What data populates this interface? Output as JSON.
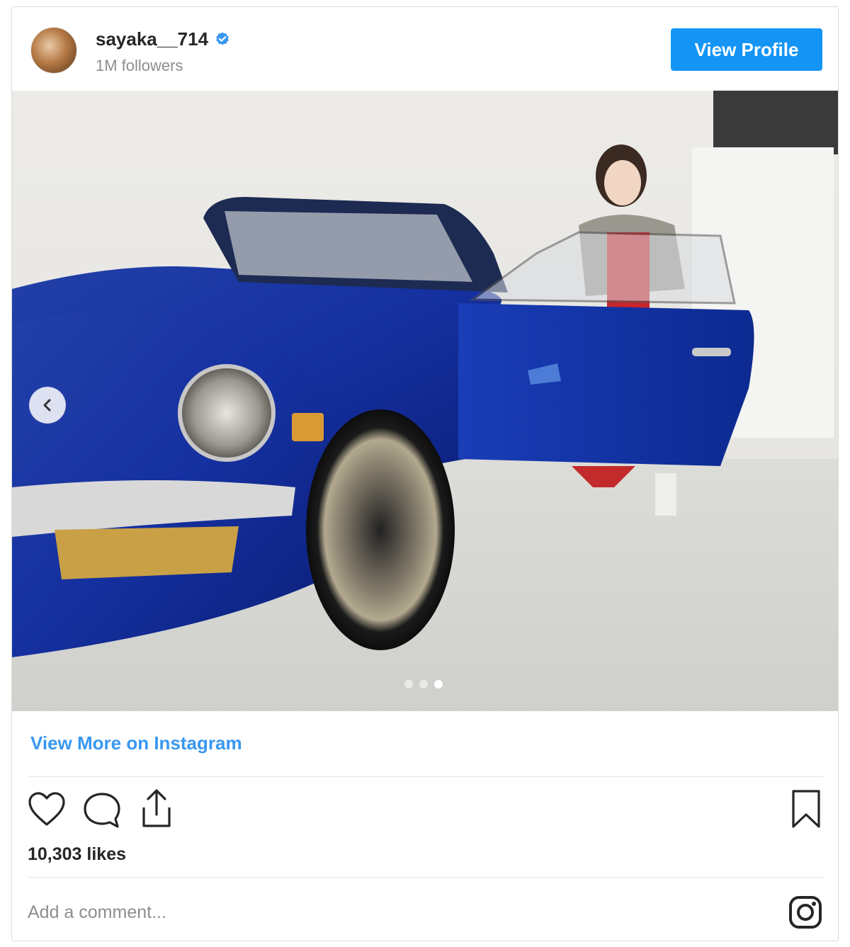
{
  "header": {
    "username": "sayaka__714",
    "verified": true,
    "followers": "1M followers",
    "view_profile_label": "View Profile"
  },
  "post": {
    "image_description_icon": "photo",
    "carousel": {
      "count": 3,
      "active_index": 2
    }
  },
  "links": {
    "view_more_label": "View More on Instagram"
  },
  "actions": {
    "like_icon": "heart-icon",
    "comment_icon": "comment-icon",
    "share_icon": "share-icon",
    "save_icon": "bookmark-icon"
  },
  "likes_text": "10,303 likes",
  "comment": {
    "placeholder": "Add a comment..."
  },
  "footer": {
    "brand_icon": "instagram-icon"
  },
  "colors": {
    "accent": "#1495f6",
    "link": "#3897f0",
    "muted": "#8e8e8e",
    "text": "#262626",
    "verified": "#3897f0"
  }
}
